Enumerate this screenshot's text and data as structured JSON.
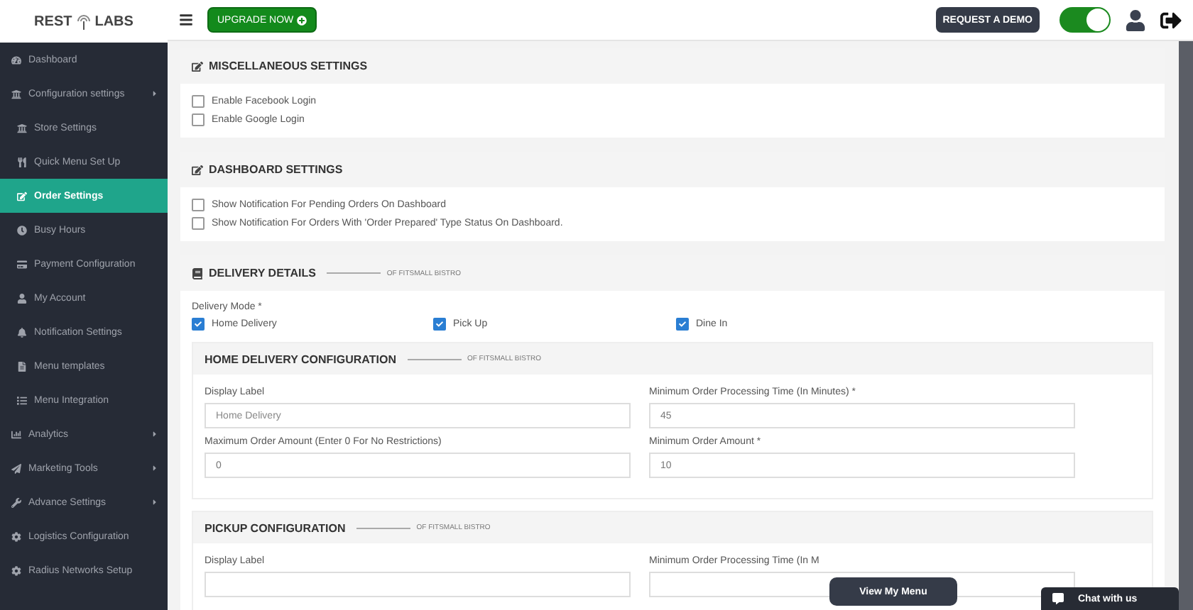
{
  "logo": {
    "left": "REST",
    "right": "LABS"
  },
  "sidebar": {
    "items": [
      {
        "label": "Dashboard",
        "kind": "top",
        "has_submenu": false,
        "selected": false
      },
      {
        "label": "Configuration settings",
        "kind": "top",
        "has_submenu": true,
        "selected": false
      },
      {
        "label": "Store Settings",
        "kind": "sub",
        "has_submenu": false,
        "selected": false
      },
      {
        "label": "Quick Menu Set Up",
        "kind": "sub",
        "has_submenu": false,
        "selected": false
      },
      {
        "label": "Order Settings",
        "kind": "sub",
        "has_submenu": false,
        "selected": true
      },
      {
        "label": "Busy Hours",
        "kind": "sub",
        "has_submenu": false,
        "selected": false
      },
      {
        "label": "Payment Configuration",
        "kind": "sub",
        "has_submenu": false,
        "selected": false
      },
      {
        "label": "My Account",
        "kind": "sub",
        "has_submenu": false,
        "selected": false
      },
      {
        "label": "Notification Settings",
        "kind": "sub",
        "has_submenu": false,
        "selected": false
      },
      {
        "label": "Menu templates",
        "kind": "sub",
        "has_submenu": false,
        "selected": false
      },
      {
        "label": "Menu Integration",
        "kind": "sub",
        "has_submenu": false,
        "selected": false
      },
      {
        "label": "Analytics",
        "kind": "top",
        "has_submenu": true,
        "selected": false
      },
      {
        "label": "Marketing Tools",
        "kind": "top",
        "has_submenu": true,
        "selected": false
      },
      {
        "label": "Advance Settings",
        "kind": "top",
        "has_submenu": true,
        "selected": false
      },
      {
        "label": "Logistics Configuration",
        "kind": "top",
        "has_submenu": false,
        "selected": false
      },
      {
        "label": "Radius Networks Setup",
        "kind": "top",
        "has_submenu": false,
        "selected": false
      }
    ]
  },
  "topbar": {
    "upgrade": "UPGRADE NOW",
    "demo": "REQUEST A DEMO",
    "toggle_on": true
  },
  "misc": {
    "title": "MISCELLANEOUS SETTINGS",
    "options": [
      {
        "label": "Enable Facebook Login",
        "checked": false
      },
      {
        "label": "Enable Google Login",
        "checked": false
      }
    ]
  },
  "dashboard": {
    "title": "DASHBOARD SETTINGS",
    "options": [
      {
        "label": "Show Notification For Pending Orders On Dashboard",
        "checked": false
      },
      {
        "label": "Show Notification For Orders With 'Order Prepared' Type Status On Dashboard.",
        "checked": false
      }
    ]
  },
  "delivery": {
    "title": "DELIVERY DETAILS",
    "subtitle": "OF FITSMALL BISTRO",
    "mode_label": "Delivery Mode *",
    "modes": [
      {
        "label": "Home Delivery",
        "checked": true
      },
      {
        "label": "Pick Up",
        "checked": true
      },
      {
        "label": "Dine In",
        "checked": true
      }
    ],
    "configs": [
      {
        "title": "HOME DELIVERY CONFIGURATION",
        "subtitle": "OF FITSMALL BISTRO",
        "fields": [
          {
            "label": "Display Label",
            "placeholder": "Home Delivery"
          },
          {
            "label": "Minimum Order Processing Time (In Minutes) *",
            "value": "45"
          },
          {
            "label": "Maximum Order Amount (Enter 0 For No Restrictions)",
            "value": "0"
          },
          {
            "label": "Minimum Order Amount *",
            "value": "10"
          }
        ]
      },
      {
        "title": "PICKUP CONFIGURATION",
        "subtitle": "OF FITSMALL BISTRO",
        "fields": [
          {
            "label": "Display Label"
          },
          {
            "label": "Minimum Order Processing Time (In M"
          }
        ]
      }
    ]
  },
  "view_menu": "View My Menu",
  "chat": "Chat with us"
}
